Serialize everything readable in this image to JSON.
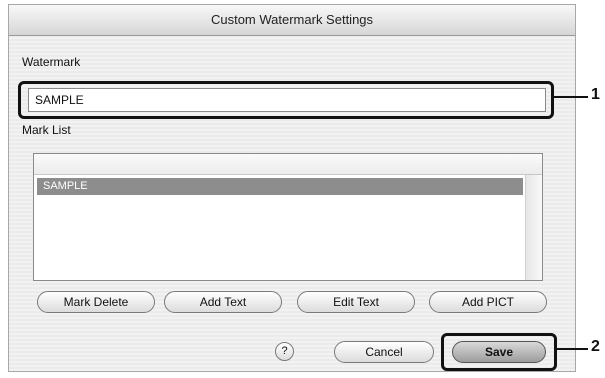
{
  "dialog": {
    "title": "Custom Watermark Settings",
    "watermark_label": "Watermark",
    "watermark_value": "SAMPLE",
    "mark_list_label": "Mark List",
    "mark_list": [
      "SAMPLE"
    ],
    "buttons": {
      "mark_delete": "Mark Delete",
      "add_text": "Add Text",
      "edit_text": "Edit Text",
      "add_pict": "Add PICT",
      "help": "?",
      "cancel": "Cancel",
      "save": "Save"
    }
  },
  "callouts": [
    "1",
    "2"
  ]
}
